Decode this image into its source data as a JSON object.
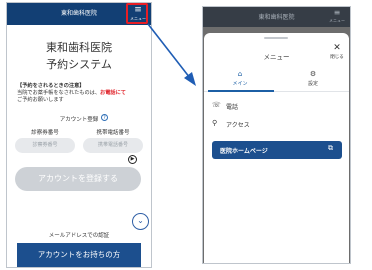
{
  "left": {
    "header_title": "東和歯科医院",
    "menu_label": "メニュー",
    "menu_icon": "≡",
    "site_title_1": "東和歯科医院",
    "site_title_2": "予約システム",
    "notice_head": "【予約をされるときの注意】",
    "notice_text_1": "当院でお薬手帳をなされたものは、",
    "notice_red": "お電話にて",
    "notice_text_2": "ご予約お願いします",
    "register_label": "アカウント登録",
    "help_icon": "?",
    "col_1_label": "診察券番号",
    "col_2_label": "携帯電話番号",
    "field_1_placeholder": "診察券番号",
    "field_2_placeholder": "携帯電話番号",
    "play_icon": "▶",
    "register_button": "アカウントを登録する",
    "down_icon": "⌄",
    "email_line": "メールアドレスでの認証",
    "has_account_button": "アカウントをお持ちの方"
  },
  "right": {
    "header_title": "東和歯科医院",
    "menu_icon": "≡",
    "menu_label": "メニュー",
    "sheet_title": "メニュー",
    "close_icon": "✕",
    "close_label": "閉じる",
    "tabs": [
      {
        "icon": "⌂",
        "label": "メイン"
      },
      {
        "icon": "⚙",
        "label": "設定"
      }
    ],
    "items": [
      {
        "icon": "☏",
        "label": "電話"
      },
      {
        "icon": "⚲",
        "label": "アクセス"
      }
    ],
    "hospital_button": "医院ホームページ",
    "external_icon": "⧉"
  },
  "colors": {
    "brand_navy": "#123f74",
    "highlight_red": "#e81e25",
    "arrow_blue": "#1f5db4"
  }
}
